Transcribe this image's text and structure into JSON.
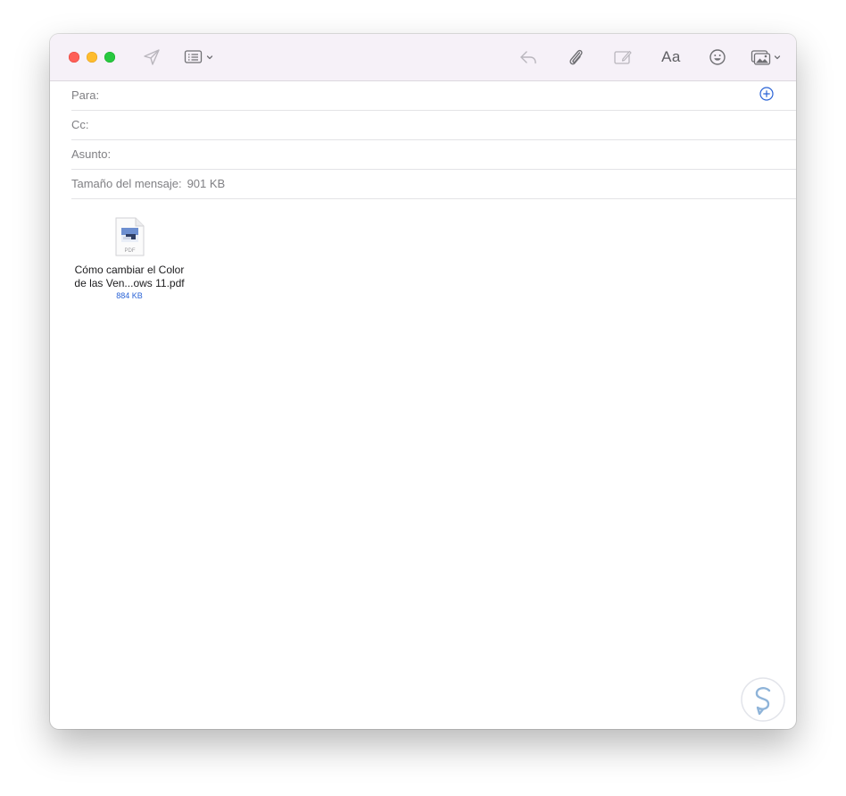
{
  "window": {
    "toolbar": {
      "icons": [
        "send-icon",
        "header-fields-icon",
        "reply-icon",
        "paperclip-icon",
        "markup-icon",
        "font-icon",
        "emoji-icon",
        "photo-browser-icon"
      ],
      "font_label": "Aa"
    },
    "fields": {
      "to_label": "Para:",
      "cc_label": "Cc:",
      "subject_label": "Asunto:",
      "size_label": "Tamaño del mensaje:",
      "size_value": "901 KB"
    },
    "attachment": {
      "type_label": "PDF",
      "name_line1": "Cómo cambiar el Color",
      "name_line2": "de las Ven...ows 11.pdf",
      "size": "884 KB"
    },
    "colors": {
      "accent": "#2a63d6",
      "toolbar_bg": "#f6f1f8",
      "close": "#fe5f57",
      "minimize": "#febc2e",
      "zoom": "#28c840"
    }
  }
}
